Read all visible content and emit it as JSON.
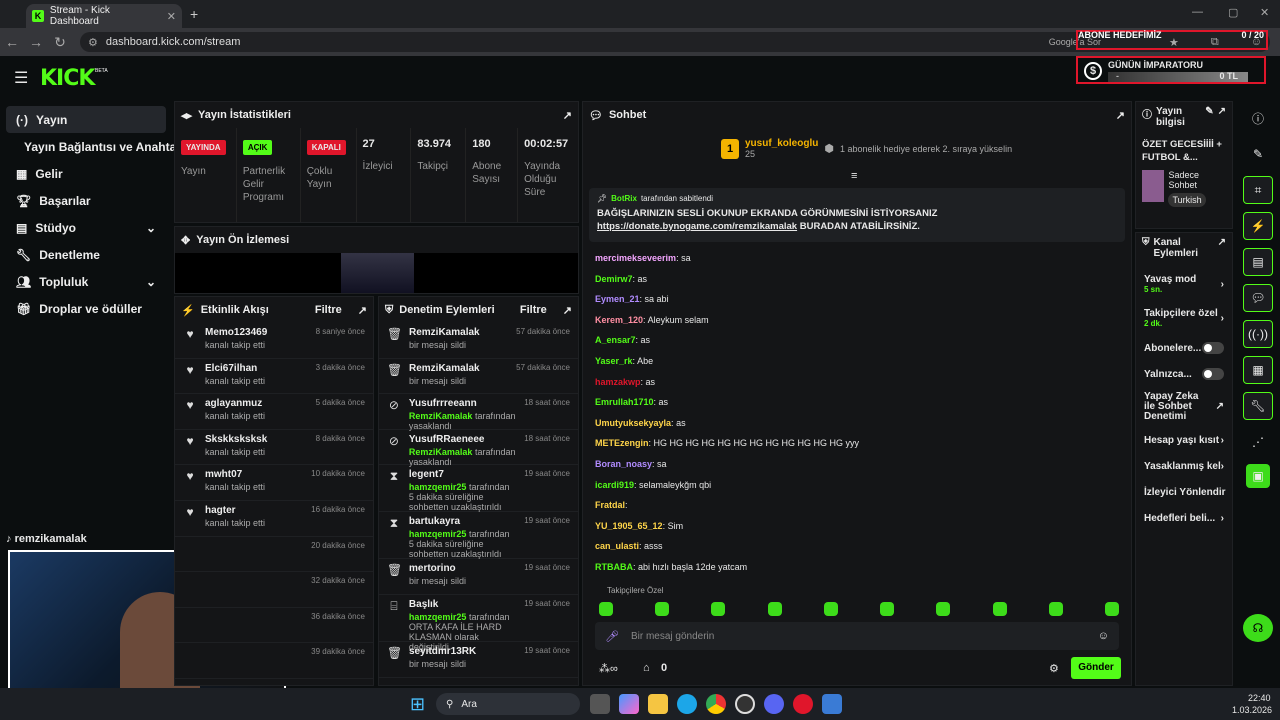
{
  "browser": {
    "tab_title": "Stream - Kick Dashboard",
    "url": "dashboard.kick.com/stream",
    "google_btn": "Google'a Sor"
  },
  "overlay": {
    "goal_title": "ABONE HEDEFİMİZ",
    "goal_count": "0 / 20",
    "emperor_title": "GÜNÜN İMPARATORU",
    "emperor_dash": "-",
    "emperor_amount": "0 TL"
  },
  "sidebar": {
    "items": [
      {
        "label": "Yayın"
      },
      {
        "label": "Yayın Bağlantısı ve Anahtarı"
      },
      {
        "label": "Gelir"
      },
      {
        "label": "Başarılar"
      },
      {
        "label": "Stüdyo"
      },
      {
        "label": "Denetleme"
      },
      {
        "label": "Topluluk"
      },
      {
        "label": "Droplar ve ödüller"
      }
    ],
    "username": "remzikamalak"
  },
  "stats": {
    "title": "Yayın İstatistikleri",
    "items": [
      {
        "badge": "YAYINDA",
        "label": "Yayın",
        "color": "#e0162b"
      },
      {
        "badge": "AÇIK",
        "label": "Partnerlik Gelir Programı",
        "color": "#53fc18"
      },
      {
        "badge": "KAPALI",
        "label": "Çoklu Yayın",
        "color": "#e0162b"
      },
      {
        "value": "27",
        "label": "İzleyici"
      },
      {
        "value": "83.974",
        "label": "Takipçi"
      },
      {
        "value": "180",
        "label": "Abone Sayısı"
      },
      {
        "value": "00:02:57",
        "label": "Yayında Olduğu Süre"
      }
    ]
  },
  "preview": {
    "title": "Yayın Ön İzlemesi"
  },
  "activity": {
    "title": "Etkinlik Akışı",
    "filter": "Filtre",
    "rows": [
      {
        "name": "Memo123469",
        "sub": "kanalı takip etti",
        "time": "8 saniye önce"
      },
      {
        "name": "Elci67ilhan",
        "sub": "kanalı takip etti",
        "time": "3 dakika önce"
      },
      {
        "name": "aglayanmuz",
        "sub": "kanalı takip etti",
        "time": "5 dakika önce"
      },
      {
        "name": "Skskksksksk",
        "sub": "kanalı takip etti",
        "time": "8 dakika önce"
      },
      {
        "name": "mwht07",
        "sub": "kanalı takip etti",
        "time": "10 dakika önce"
      },
      {
        "name": "hagter",
        "sub": "kanalı takip etti",
        "time": "16 dakika önce"
      },
      {
        "name": "",
        "sub": "",
        "time": "20 dakika önce"
      },
      {
        "name": "",
        "sub": "",
        "time": "32 dakika önce"
      },
      {
        "name": "",
        "sub": "",
        "time": "36 dakika önce"
      },
      {
        "name": "",
        "sub": "",
        "time": "39 dakika önce"
      }
    ]
  },
  "moderation": {
    "title": "Denetim Eylemleri",
    "filter": "Filtre",
    "rows": [
      {
        "name": "RemziKamalak",
        "sub": "bir mesajı sildi",
        "time": "57 dakika önce",
        "icon": "trash"
      },
      {
        "name": "RemziKamalak",
        "sub": "bir mesajı sildi",
        "time": "57 dakika önce",
        "icon": "trash"
      },
      {
        "name": "Yusufrrreeann",
        "actor": "RemziKamalak",
        "sub": "tarafından yasaklandı",
        "time": "18 saat önce",
        "icon": "ban"
      },
      {
        "name": "YusufRRaeneee",
        "actor": "RemziKamalak",
        "sub": "tarafından yasaklandı",
        "time": "18 saat önce",
        "icon": "ban"
      },
      {
        "name": "legent7",
        "actor": "hamzqemir25",
        "sub": "tarafından 5 dakika süreliğine sohbetten uzaklaştırıldı",
        "time": "19 saat önce",
        "icon": "hourglass"
      },
      {
        "name": "bartukayra",
        "actor": "hamzqemir25",
        "sub": "tarafından 5 dakika süreliğine sohbetten uzaklaştırıldı",
        "time": "19 saat önce",
        "icon": "hourglass"
      },
      {
        "name": "mertorino",
        "sub": "bir mesajı sildi",
        "time": "19 saat önce",
        "icon": "trash"
      },
      {
        "name": "Başlık",
        "actor": "hamzqemir25",
        "sub": "tarafından ORTA KAFA İLE HARD KLASMAN olarak değiştirildi",
        "time": "19 saat önce",
        "icon": "title"
      },
      {
        "name": "seyitdmr13RK",
        "sub": "bir mesajı sildi",
        "time": "19 saat önce",
        "icon": "trash"
      }
    ]
  },
  "chat": {
    "title": "Sohbet",
    "gift_user": "yusuf_koleoglu",
    "gift_count": "25",
    "gift_text": "1 abonelik hediye ederek 2. sıraya yükselin",
    "pinned_by": "BotRix",
    "pinned_suffix": "tarafından sabitlendi",
    "pinned_msg": "BAĞIŞLARINIZIN SESLİ OKUNUP EKRANDA GÖRÜNMESİNİ İSTİYORSANIZ",
    "pinned_link": "https://donate.bynogame.com/remzikamalak",
    "pinned_tail": "BURADAN ATABİLİRSİNİZ.",
    "messages": [
      {
        "u": "mercimekseveerim",
        "m": "sa",
        "c": "#f4a6ff"
      },
      {
        "u": "Demirw7",
        "m": "as",
        "c": "#53fc18"
      },
      {
        "u": "Eymen_21",
        "m": "sa abi",
        "c": "#b18cff"
      },
      {
        "u": "Kerem_120",
        "m": "Aleykum selam",
        "c": "#ff8fa3"
      },
      {
        "u": "A_ensar7",
        "m": "as",
        "c": "#53fc18"
      },
      {
        "u": "Yaser_rk",
        "m": "Abe",
        "c": "#53fc18"
      },
      {
        "u": "hamzakwp",
        "m": "as",
        "c": "#e0162b"
      },
      {
        "u": "Emrullah1710",
        "m": "as",
        "c": "#53fc18"
      },
      {
        "u": "Umutyuksekyayla",
        "m": "as",
        "c": "#ffd54a"
      },
      {
        "u": "METEzengin",
        "m": "HG HG HG HG HG HG HG HG HG HG HG HG yyy",
        "c": "#ffd54a"
      },
      {
        "u": "Boran_noasy",
        "m": "sa",
        "c": "#b18cff"
      },
      {
        "u": "icardi919",
        "m": "selamaleykğm qbi",
        "c": "#53fc18"
      },
      {
        "u": "Fratdal",
        "m": "",
        "c": "#ffd54a"
      },
      {
        "u": "YU_1905_65_12",
        "m": "Sim",
        "c": "#ffd54a"
      },
      {
        "u": "can_ulasti",
        "m": "asss",
        "c": "#ffd54a"
      },
      {
        "u": "RTBABA",
        "m": "abi hızlı başla 12de yatcam",
        "c": "#53fc18"
      }
    ],
    "followers_only": "Takipçilere Özel",
    "placeholder": "Bir mesaj gönderin",
    "send": "Gönder",
    "points": "0"
  },
  "info": {
    "title": "Yayın bilgisi",
    "stream_title": "ÖZET GECESİİİİ + FUTBOL &...",
    "category": "Sadece Sohbet",
    "language": "Turkish"
  },
  "channel": {
    "title": "Kanal Eylemleri",
    "slow": "Yavaş mod",
    "slow_val": "5 sn.",
    "followers": "Takipçilere özel",
    "followers_val": "2 dk.",
    "subs": "Abonelere...",
    "emotes": "Yalnızca...",
    "ai": "Yapay Zeka ile Sohbet Denetimi",
    "age": "Hesap yaşı kısıt",
    "banned": "Yasaklanmış kel",
    "redirect": "İzleyici Yönlendir",
    "goals": "Hedefleri beli..."
  },
  "taskbar": {
    "search": "Ara",
    "time": "22:40",
    "date": "1.03.2026"
  }
}
